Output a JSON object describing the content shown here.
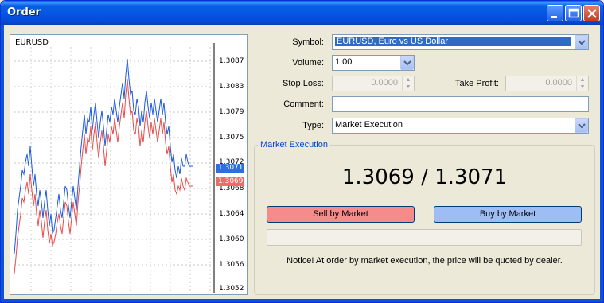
{
  "window": {
    "title": "Order"
  },
  "chart": {
    "symbol_label": "EURUSD",
    "price_labels": [
      "1.3087",
      "1.3083",
      "1.3079",
      "1.3075",
      "1.3072",
      "1.3068",
      "1.3064",
      "1.3060",
      "1.3056",
      "1.3052"
    ],
    "ask_price": "1.3071",
    "bid_price": "1.3069",
    "colors": {
      "ask_line": "#1b59e0",
      "bid_line": "#e84a4a",
      "grid": "#c8c8c8"
    }
  },
  "form": {
    "symbol_label": "Symbol:",
    "symbol_value": "EURUSD, Euro vs US Dollar",
    "volume_label": "Volume:",
    "volume_value": "1.00",
    "stop_loss_label": "Stop Loss:",
    "stop_loss_value": "0.0000",
    "take_profit_label": "Take Profit:",
    "take_profit_value": "0.0000",
    "comment_label": "Comment:",
    "comment_value": "",
    "type_label": "Type:",
    "type_value": "Market Execution"
  },
  "market_execution": {
    "group_title": "Market Execution",
    "quote": "1.3069 / 1.3071",
    "sell_label": "Sell by Market",
    "buy_label": "Buy by Market",
    "notice": "Notice! At order by market execution, the price will be quoted by dealer."
  }
}
